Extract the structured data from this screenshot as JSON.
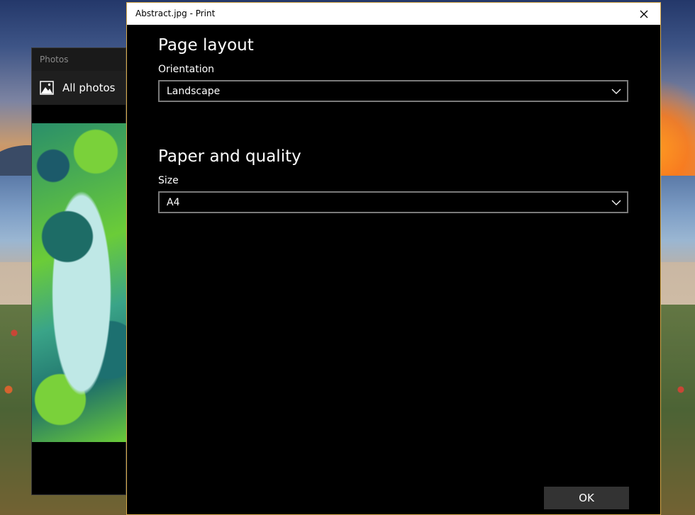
{
  "photos_app": {
    "title": "Photos",
    "nav_item": {
      "label": "All photos",
      "icon": "photo-icon"
    }
  },
  "print_dialog": {
    "title": "Abstract.jpg - Print",
    "close_icon": "close-icon",
    "page_layout": {
      "heading": "Page layout",
      "orientation_label": "Orientation",
      "orientation_value": "Landscape"
    },
    "paper_quality": {
      "heading": "Paper and quality",
      "size_label": "Size",
      "size_value": "A4"
    },
    "ok_label": "OK"
  },
  "colors": {
    "dialog_border": "#d7a94a",
    "dialog_bg": "#000000",
    "button_bg": "#333333"
  }
}
